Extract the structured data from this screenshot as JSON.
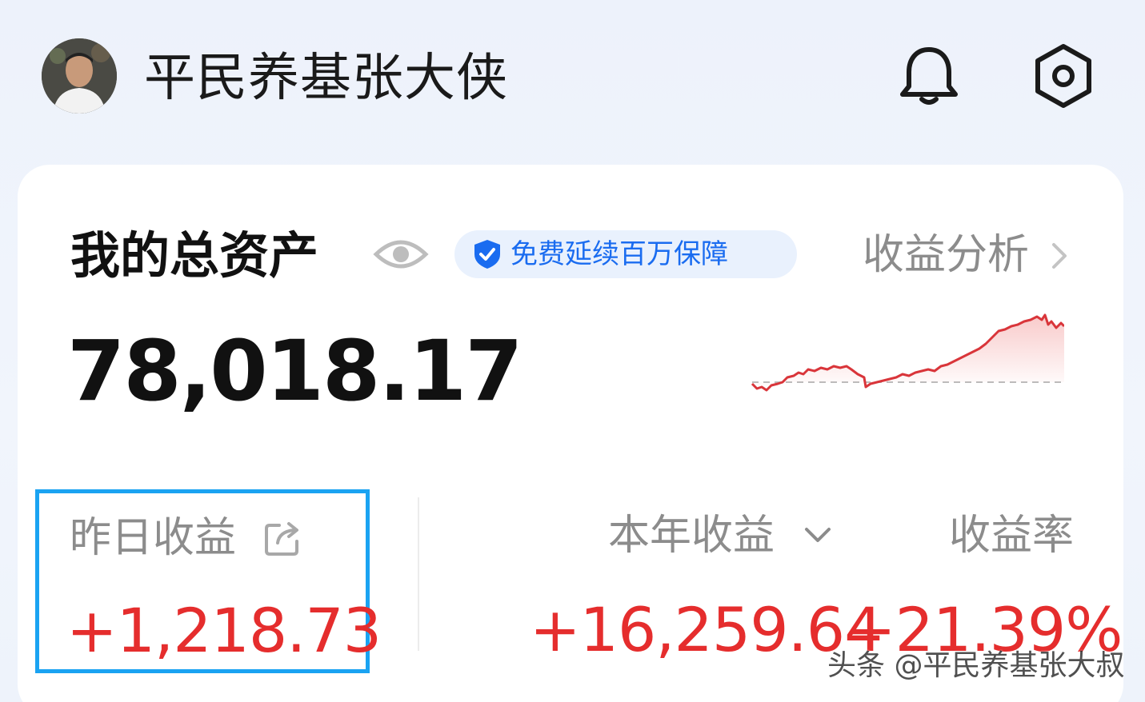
{
  "header": {
    "user_name": "平民养基张大侠",
    "icons": {
      "notification": "bell-icon",
      "settings": "settings-icon"
    }
  },
  "assets": {
    "title": "我的总资产",
    "visibility_icon": "eye-icon",
    "guarantee_badge": "免费延续百万保障",
    "analysis_link": "收益分析",
    "total_amount": "78,018.17"
  },
  "stats": {
    "yesterday": {
      "label": "昨日收益",
      "value": "+1,218.73"
    },
    "year": {
      "label": "本年收益",
      "value": "+16,259.64"
    },
    "rate": {
      "label": "收益率",
      "value": "+21.39%"
    }
  },
  "colors": {
    "accent_blue": "#1a6cf0",
    "gain_red": "#e52d2d",
    "highlight_border": "#1aa3f2",
    "muted_text": "#8c8c8c"
  },
  "watermark": "头条 @平民养基张大叔"
}
